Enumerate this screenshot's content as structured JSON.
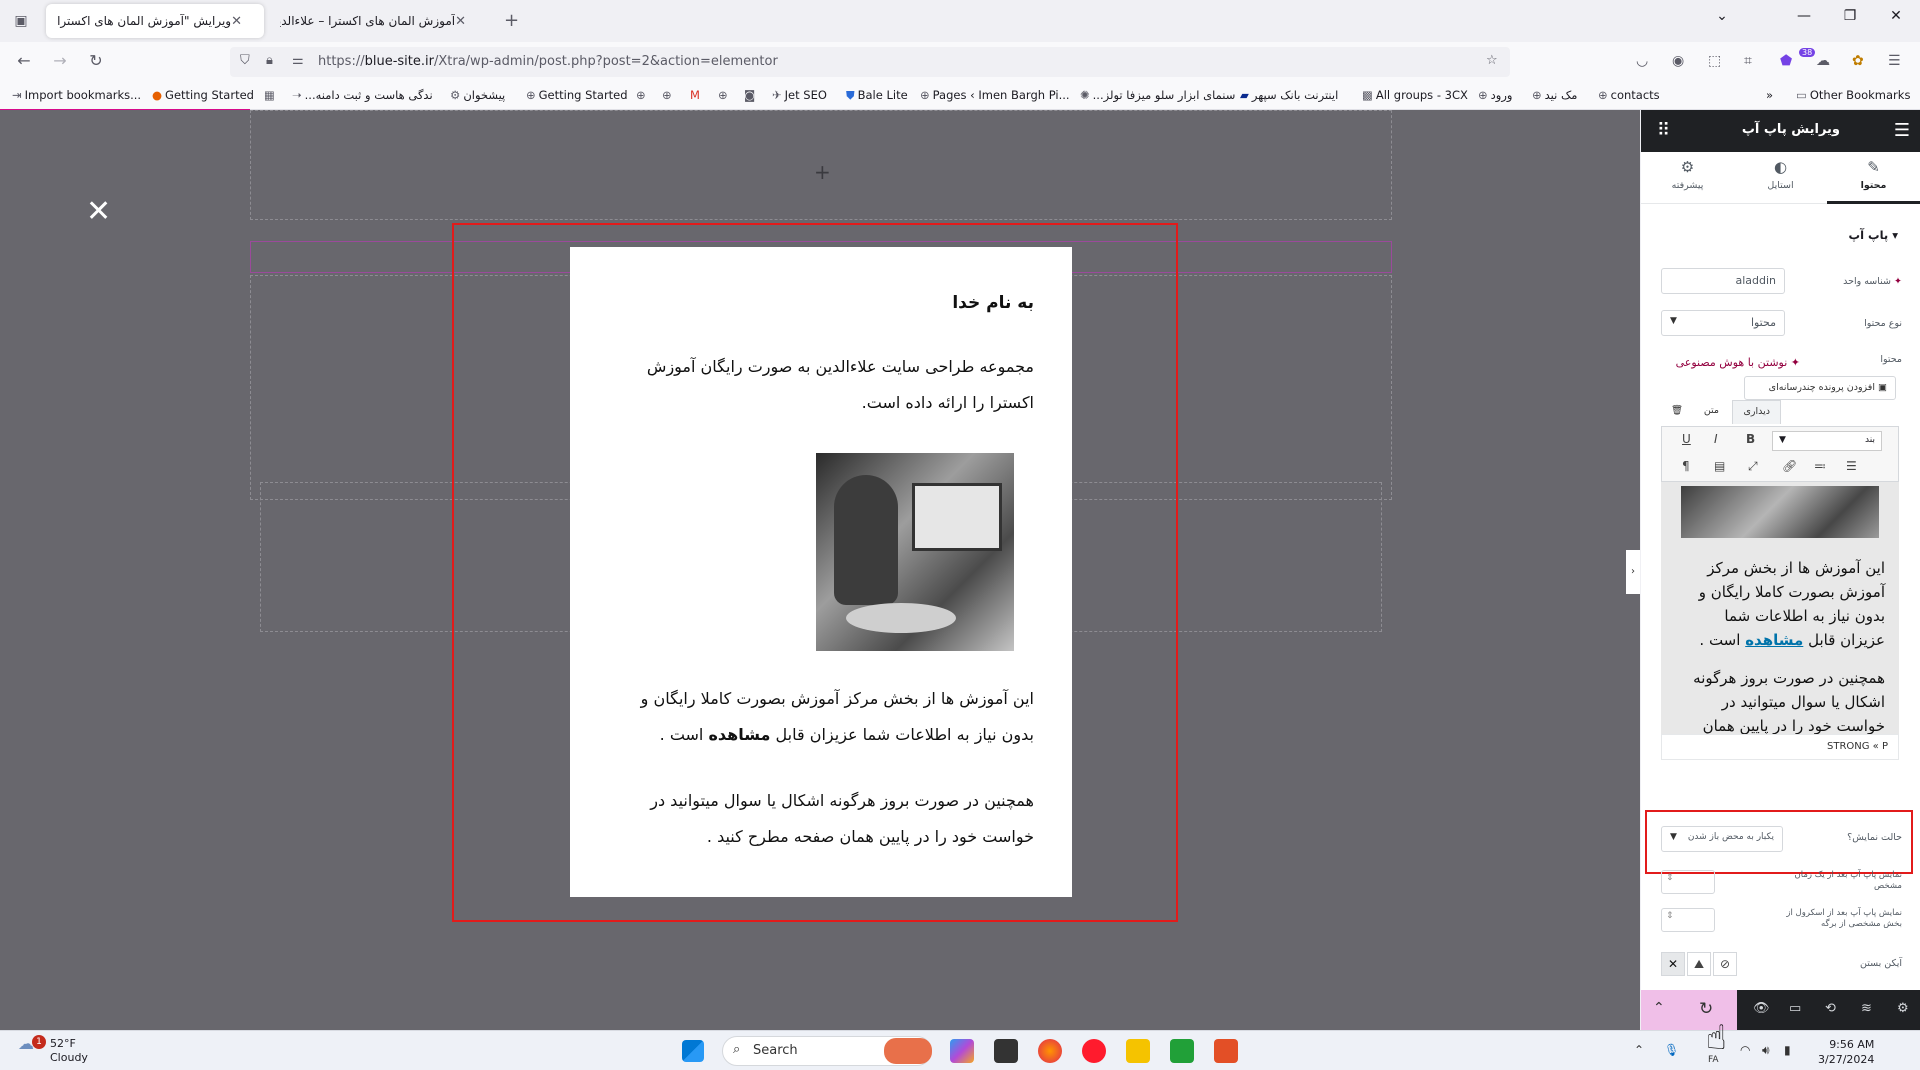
{
  "browser": {
    "tabs": [
      {
        "title": "ویرایش \"آموزش المان های اکسترا ...",
        "active": true
      },
      {
        "title": "آموزش المان های اکسترا – علاءالدین",
        "active": false
      }
    ],
    "url_prefix": "https://",
    "url_domain": "blue-site.ir",
    "url_path": "/Xtra/wp-admin/post.php?post=2&action=elementor",
    "extension_badge": "38",
    "bookmarks": [
      "Import bookmarks...",
      "Getting Started",
      "...ندگی هاست و ثبت دامنه",
      "پیشخوان",
      "Getting Started",
      "Jet SEO",
      "Bale Lite",
      "Pages ‹ Imen Bargh Pi...",
      "...سنمای ابزار سلو میزفا تولز",
      "اینترنت بانک سپهر",
      "All groups - 3CX",
      "ورود",
      "مک نید",
      "contacts"
    ],
    "other_bookmarks": "Other Bookmarks"
  },
  "popup": {
    "heading": "به نام خدا",
    "para1": "مجموعه طراحی سایت علاءالدین به صورت رایگان آموزش اکسترا را ارائه داده است.",
    "para2_prefix": "این آموزش ها از بخش مرکز آموزش بصورت کاملا رایگان و بدون نیاز به اطلاعات شما عزیزان قابل",
    "para2_bold": "مشاهده",
    "para2_suffix": "است .",
    "para3": "همچنین در صورت بروز هرگونه اشکال یا سوال میتوانید در خواست خود را در پایین همان صفحه مطرح کنید ."
  },
  "panel": {
    "title": "ویرایش پاپ آپ",
    "tabs": [
      {
        "label": "محتوا",
        "icon": "pencil-icon"
      },
      {
        "label": "استایل",
        "icon": "half-circle-icon"
      },
      {
        "label": "پیشرفته",
        "icon": "gear-icon"
      }
    ],
    "section_title": "پاپ آپ",
    "id_label": "شناسه واحد",
    "id_value": "aladdin",
    "content_type_label": "نوع محتوا",
    "content_type_value": "محتوا",
    "content_label": "محتوا",
    "ai_link": "نوشتن با هوش مصنوعی",
    "add_media": "افزودن پرونده چندرسانه‌ای",
    "editor_tab_visual": "دیداری",
    "editor_tab_text": "متن",
    "format_select": "بند",
    "editor_text1_prefix": "این آموزش ها از بخش مرکز آموزش بصورت کاملا رایگان و بدون نیاز به اطلاعات شما عزیزان قابل",
    "editor_text1_link": "مشاهده",
    "editor_text1_suffix": "است .",
    "editor_text2": "همچنین در صورت بروز هرگونه اشکال یا سوال میتوانید در خواست خود را در پایین همان صفحه مطرح کنید .",
    "editor_path": "STRONG « P",
    "display_mode_label": "حالت نمایش؟",
    "display_mode_value": "یکبار به محض باز شدن",
    "delay_label": "نمایش پاپ آپ بعد از یک زمان مشخص",
    "scroll_label": "نمایش پاپ آپ بعد از اسکرول از بخش مشخصی از برگه",
    "close_icon_label": "آیکن بستن"
  },
  "taskbar": {
    "weather_temp": "52°F",
    "weather_desc": "Cloudy",
    "weather_badge": "1",
    "search_placeholder": "Search",
    "time": "9:56 AM",
    "date": "3/27/2024",
    "lang": "FA"
  },
  "colors": {
    "accent_red": "#e21b1b",
    "panel_dark": "#1f2124",
    "canvas_bg": "#68676d",
    "update_pink": "#f0bfe8"
  }
}
